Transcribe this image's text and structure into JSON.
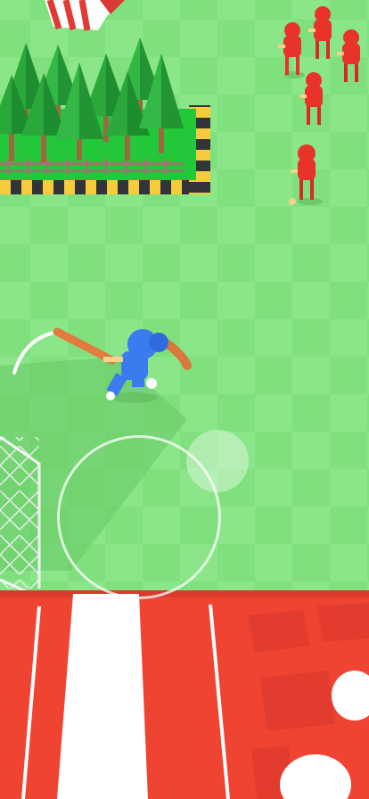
{
  "game": {
    "player": {
      "team_color": "#3a7bf0",
      "weapon": "baseball-bat"
    },
    "enemies": {
      "team_color": "#e8332b",
      "count_visible": 6
    },
    "ground_color": "#7fe07c",
    "forest": {
      "trees_visible": 16,
      "border_pattern": "yellow-black-stripes"
    },
    "base": {
      "color": "#f04433",
      "lane_color": "#ffffff"
    },
    "joystick": {
      "state": "idle"
    }
  }
}
